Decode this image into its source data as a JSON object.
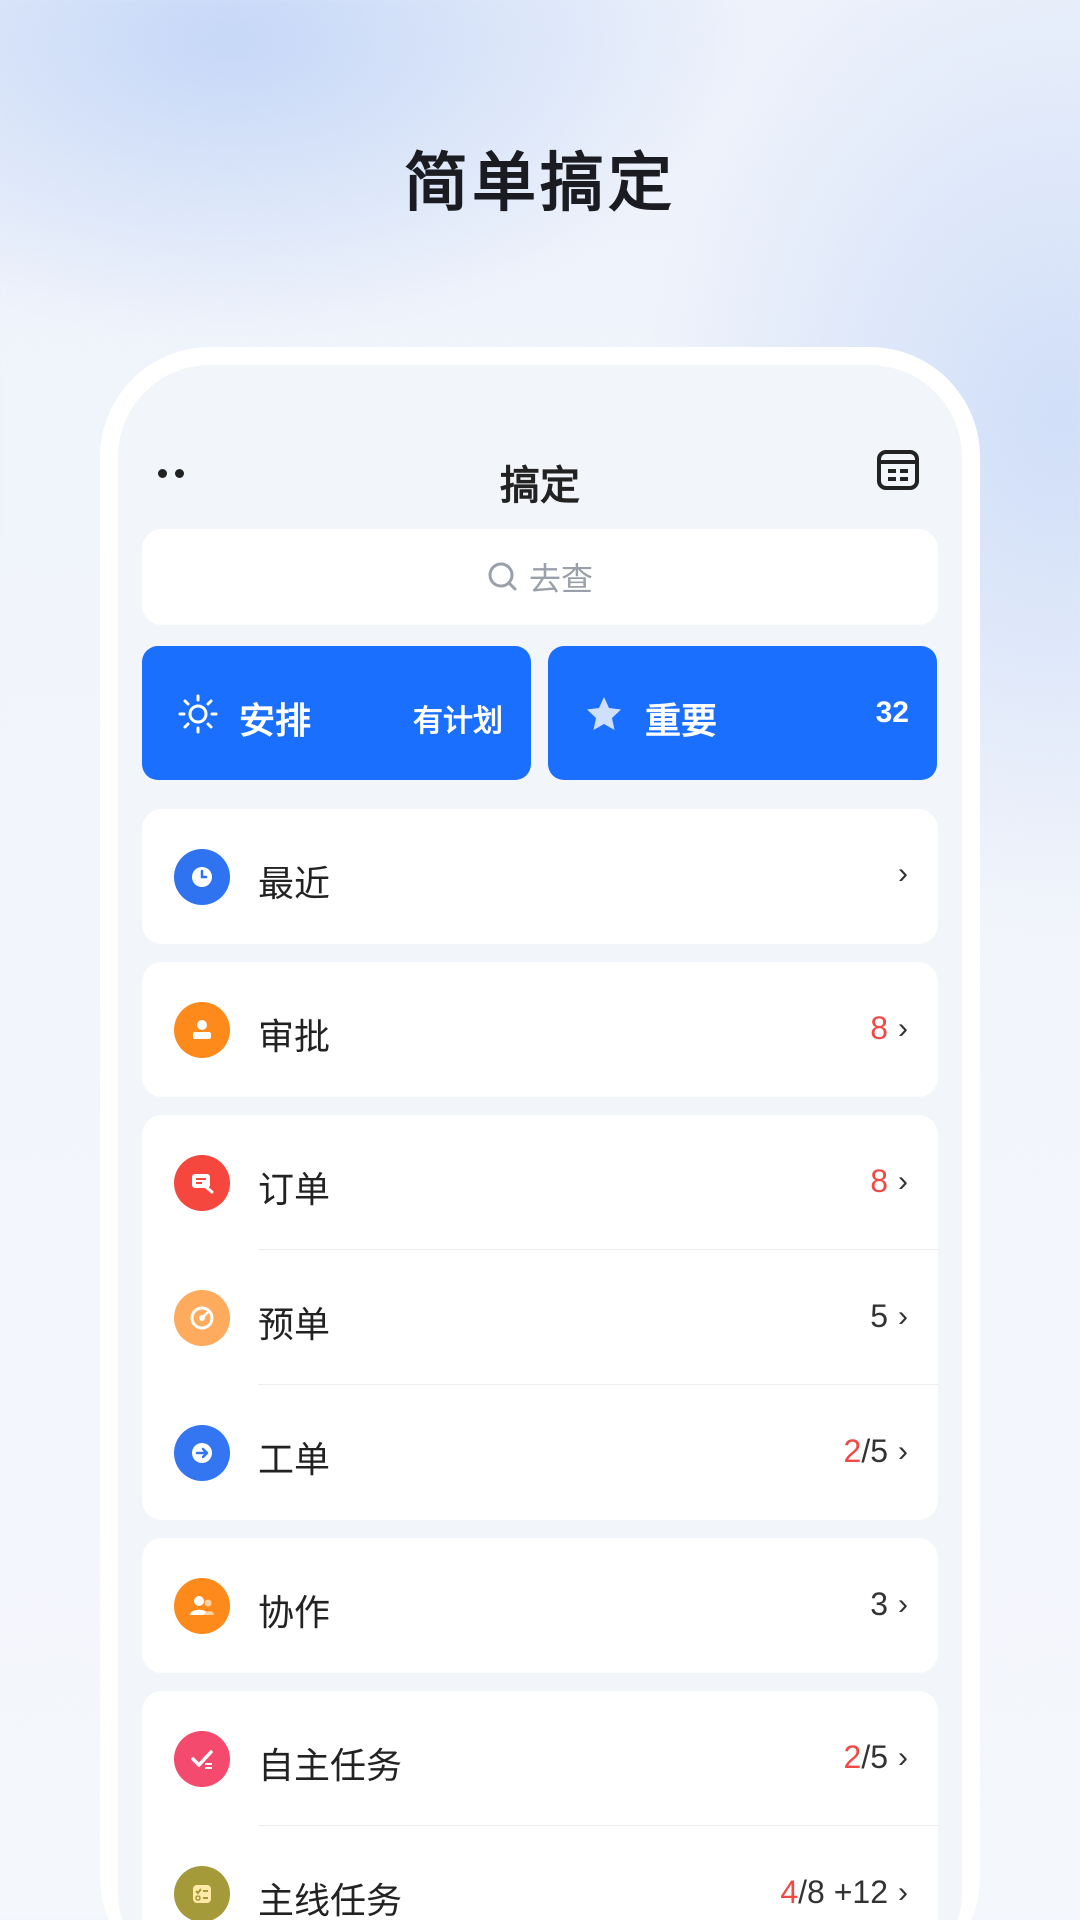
{
  "hero": {
    "title": "简单搞定"
  },
  "navbar": {
    "title": "搞定",
    "more_icon": "more-dots-icon",
    "calendar_icon": "calendar-icon"
  },
  "search": {
    "placeholder": "去查",
    "icon": "search-icon"
  },
  "quick": {
    "left": {
      "label": "安排",
      "value": "有计划",
      "icon": "sun-icon"
    },
    "right": {
      "label": "重要",
      "value": "32",
      "icon": "star-icon"
    }
  },
  "colors": {
    "primary": "#1b6fff",
    "alert": "#f04a45",
    "background": "#f2f5f9"
  },
  "groups": [
    {
      "rows": [
        {
          "label": "最近",
          "icon": "clock-icon",
          "color": "#2f73f0"
        }
      ]
    },
    {
      "rows": [
        {
          "label": "审批",
          "count_red": "8",
          "icon": "stamp-icon",
          "color": "#ff8a1c"
        }
      ]
    },
    {
      "rows": [
        {
          "label": "订单",
          "count_red": "8",
          "icon": "order-icon",
          "color": "#f5473d"
        },
        {
          "label": "预单",
          "count": "5",
          "icon": "target-icon",
          "color": "#ffab5e"
        },
        {
          "label": "工单",
          "count_red": "2",
          "count": "/5",
          "icon": "arrow-right-circle-icon",
          "color": "#3476f2"
        }
      ]
    },
    {
      "rows": [
        {
          "label": "协作",
          "count": "3",
          "icon": "team-icon",
          "color": "#ff8a1c"
        }
      ]
    },
    {
      "rows": [
        {
          "label": "自主任务",
          "count_red": "2",
          "count": "/5",
          "icon": "check-list-icon",
          "color": "#f44a6d"
        },
        {
          "label": "主线任务",
          "count_red": "4",
          "count": "/8 +12",
          "icon": "task-list-icon",
          "color": "#a59a3a"
        }
      ]
    }
  ]
}
